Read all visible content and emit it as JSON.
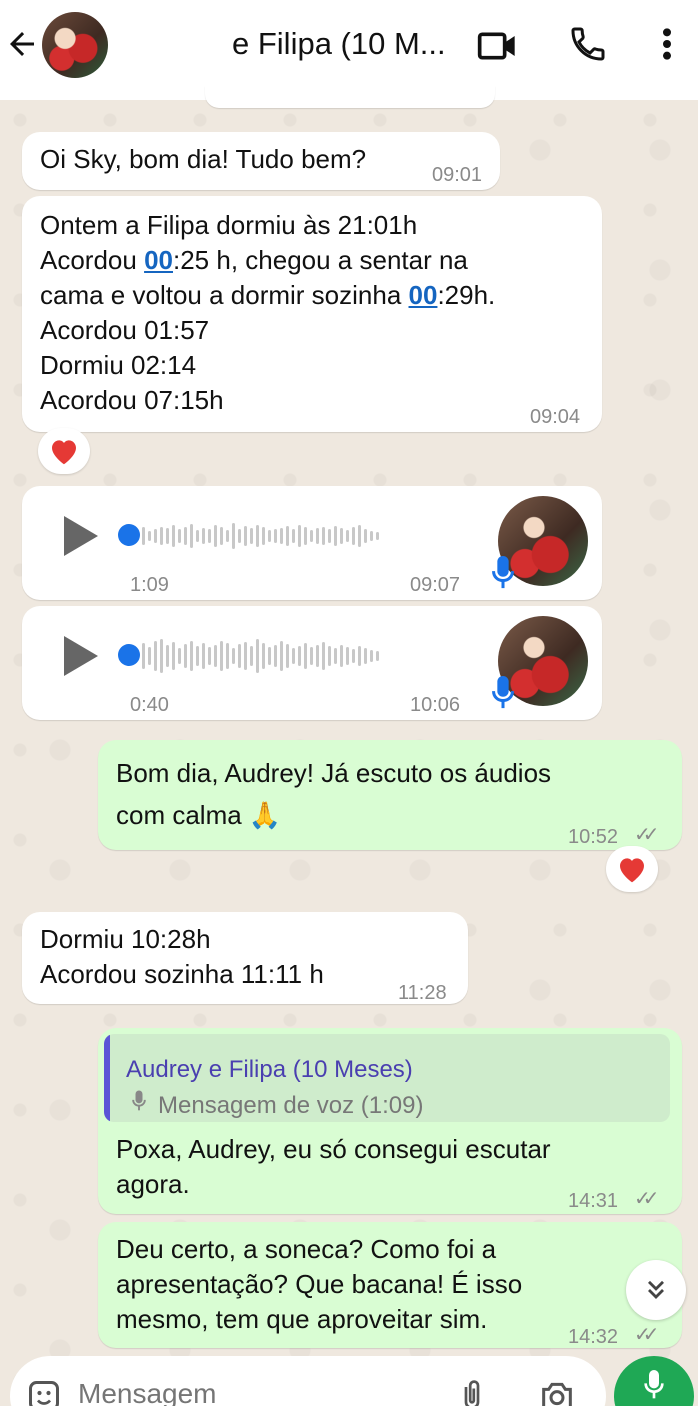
{
  "header": {
    "title": "e Filipa (10 M..."
  },
  "messages": {
    "m1": {
      "text": "Oi Sky, bom dia! Tudo bem?",
      "time": "09:01"
    },
    "m2": {
      "line1": "Ontem a Filipa dormiu às 21:01h",
      "line2_pre": "Acordou ",
      "line2_link": "00",
      "line2_post": ":25 h, chegou a sentar na",
      "line3_pre": "cama e voltou a dormir sozinha ",
      "line3_link": "00",
      "line3_post": ":29h.",
      "line4": "Acordou 01:57",
      "line5": "Dormiu 02:14",
      "line6": "Acordou 07:15h",
      "time": "09:04",
      "reaction": "❤️"
    },
    "voice1": {
      "duration": "1:09",
      "time": "09:07"
    },
    "voice2": {
      "duration": "0:40",
      "time": "10:06"
    },
    "m3": {
      "line1": "Bom dia, Audrey! Já escuto os áudios",
      "line2": "com calma 🙏",
      "time": "10:52",
      "ticks": "✓✓",
      "reaction": "❤️"
    },
    "m4": {
      "line1": "Dormiu 10:28h",
      "line2": "Acordou sozinha 11:11 h",
      "time": "11:28"
    },
    "m5": {
      "quote_author": "Audrey e Filipa (10 Meses)",
      "quote_text": "Mensagem de voz (1:09)",
      "line1": "Poxa, Audrey, eu só consegui escutar",
      "line2": "agora.",
      "time": "14:31",
      "ticks": "✓✓"
    },
    "m6": {
      "line1": "Deu certo, a soneca? Como foi a",
      "line2": "apresentação? Que bacana! É isso",
      "line3": "mesmo, tem que aproveitar sim.",
      "time": "14:32",
      "ticks": "✓✓"
    }
  },
  "input": {
    "placeholder": "Mensagem"
  },
  "colors": {
    "outgoing_bubble": "#d9fdd3",
    "incoming_bubble": "#ffffff",
    "link": "#1565c0",
    "voice_dot": "#1a73e8",
    "mic_fab": "#1fa855",
    "quote_bar": "#5b54d6"
  }
}
